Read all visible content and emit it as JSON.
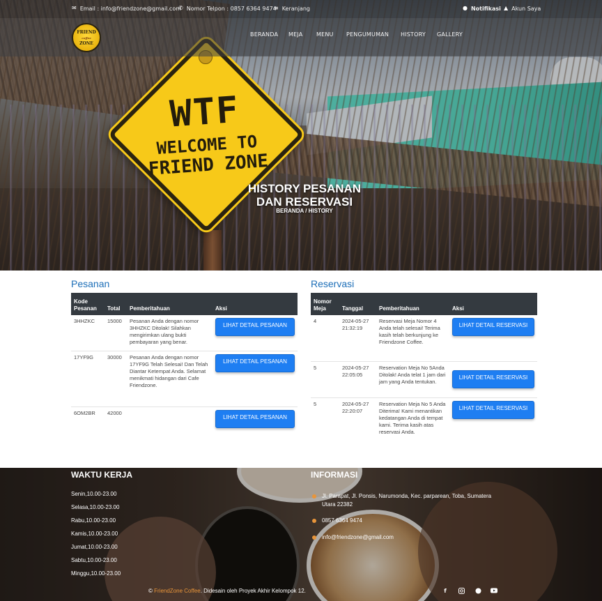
{
  "topbar": {
    "email": "Email : info@friendzone@gmail.com",
    "phone": "Nomor Telpon : 0857 6364 9474",
    "cart": "Keranjang",
    "notifications": "Notifikasi",
    "account": "Akun Saya"
  },
  "brand": {
    "logo_line1": "FRIEND",
    "logo_line2": "coffee",
    "logo_line3": "ZONE"
  },
  "nav": [
    "BERANDA",
    "MEJA",
    "MENU",
    "PENGUMUMAN",
    "HISTORY",
    "GALLERY"
  ],
  "hero": {
    "sign_line1": "WTF",
    "sign_line2": "WELCOME TO",
    "sign_line3": "FRIEND ZONE",
    "title_line1": "HISTORY PESANAN",
    "title_line2": "DAN RESERVASI",
    "breadcrumb": "BERANDA / HISTORY"
  },
  "pesanan": {
    "title": "Pesanan",
    "headers": [
      "Kode Pesanan",
      "Total",
      "Pemberitahuan",
      "Aksi"
    ],
    "button_label": "LIHAT DETAIL PESANAN",
    "rows": [
      {
        "kode": "3HHZKC",
        "total": "15000",
        "info": "Pesanan Anda dengan nomor 3HHZKC Ditolak! Silahkan mengirimkan ulang bukti pembayaran yang benar."
      },
      {
        "kode": "17YF9G",
        "total": "30000",
        "info": "Pesanan Anda dengan nomor 17YF9G Telah Selesai! Dan Telah Diantar Ketempat Anda. Selamat menikmati hidangan dari Cafe Friendzone."
      },
      {
        "kode": "6OM2BR",
        "total": "42000",
        "info": ""
      }
    ]
  },
  "reservasi": {
    "title": "Reservasi",
    "headers": [
      "Nomor Meja",
      "Tanggal",
      "Pemberitahuan",
      "Aksi"
    ],
    "button_label": "LIHAT DETAIL RESERVASI",
    "rows": [
      {
        "meja": "4",
        "tanggal": "2024-05-27 21:32:19",
        "info": "Reservasi Meja Nomor 4 Anda telah selesai! Terima kasih telah berkunjung ke Friendzone Coffee."
      },
      {
        "meja": "5",
        "tanggal": "2024-05-27 22:05:05",
        "info": "Reservation Meja No 5Anda Ditolak! Anda telat 1 jam dari jam yang Anda tentukan."
      },
      {
        "meja": "5",
        "tanggal": "2024-05-27 22:20:07",
        "info": "Reservation Meja No 5 Anda Diterima! Kami menantikan kedatangan Anda di tempat kami. Terima kasih atas reservasi Anda."
      }
    ]
  },
  "footer": {
    "hours_title": "WAKTU KERJA",
    "hours": [
      "Senin,10.00-23.00",
      "Selasa,10.00-23.00",
      "Rabu,10.00-23.00",
      "Kamis,10.00-23.00",
      "Jumat,10.00-23.00",
      "Sabtu,10.00-23.00",
      "Minggu,10.00-23.00"
    ],
    "info_title": "INFORMASI",
    "address": "Jl. Parapat, Jl. Ponsis, Narumonda, Kec. parparean, Toba, Sumatera Utara 22382",
    "phone": "0857 6364 9474",
    "email": "info@friendzone@gmail.com",
    "copyright_prefix": "© ",
    "copyright_brand": "FriendZone Coffee",
    "copyright_suffix": ". Didesain oleh Proyek Akhir Kelompok 12.",
    "social_icons": [
      "facebook-icon",
      "instagram-icon",
      "whatsapp-icon",
      "youtube-icon"
    ]
  },
  "colors": {
    "accent_blue": "#1e7ef2",
    "section_title": "#1d6fb8",
    "table_header": "#343a40",
    "footer_accent": "#e8953a",
    "sign_yellow": "#f7c919"
  }
}
